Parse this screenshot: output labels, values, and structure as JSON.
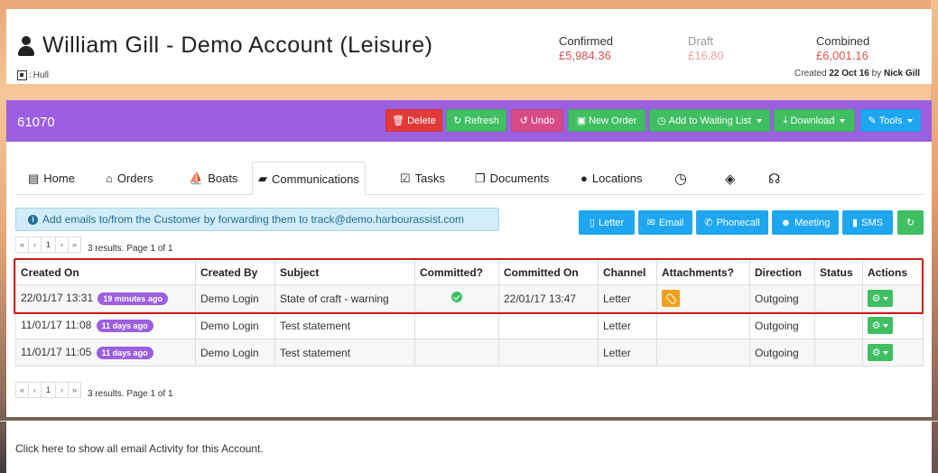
{
  "header": {
    "title": "William Gill - Demo Account (Leisure)",
    "location": "Hull",
    "confirmed_label": "Confirmed",
    "confirmed_value": "£5,984.36",
    "draft_label": "Draft",
    "draft_value": "£16.80",
    "combined_label": "Combined",
    "combined_value": "£6,001.16",
    "created_prefix": "Created",
    "created_date": "22 Oct 16",
    "created_by_word": "by",
    "created_by": "Nick Gill"
  },
  "toolbar": {
    "record_id": "61070",
    "delete": "Delete",
    "refresh": "Refresh",
    "undo": "Undo",
    "new_order": "New Order",
    "add_waiting": "Add to Waiting List",
    "download": "Download",
    "tools": "Tools"
  },
  "tabs": [
    {
      "label": "Home",
      "icon": "id-card-icon"
    },
    {
      "label": "Orders",
      "icon": "basket-icon"
    },
    {
      "label": "Boats",
      "icon": "sailboat-icon"
    },
    {
      "label": "Communications",
      "icon": "comments-icon"
    },
    {
      "label": "Tasks",
      "icon": "clipboard-check-icon"
    },
    {
      "label": "Documents",
      "icon": "documents-icon"
    },
    {
      "label": "Locations",
      "icon": "globe-icon"
    }
  ],
  "info": {
    "text": "Add emails to/from the Customer by forwarding them to track@demo.harbourassist.com"
  },
  "actions": {
    "letter": "Letter",
    "email": "Email",
    "phonecall": "Phonecall",
    "meeting": "Meeting",
    "sms": "SMS"
  },
  "pager": {
    "first": "«",
    "prev": "‹",
    "page": "1",
    "next": "›",
    "last": "»",
    "summary": "3 results. Page 1 of 1"
  },
  "table": {
    "headers": [
      "Created On",
      "Created By",
      "Subject",
      "Committed?",
      "Committed On",
      "Channel",
      "Attachments?",
      "Direction",
      "Status",
      "Actions"
    ],
    "rows": [
      {
        "created_on": "22/01/17 13:31",
        "age": "19 minutes ago",
        "created_by": "Demo Login",
        "subject": "State of craft - warning",
        "committed": true,
        "committed_on": "22/01/17 13:47",
        "channel": "Letter",
        "attachment": true,
        "direction": "Outgoing",
        "status": ""
      },
      {
        "created_on": "11/01/17 11:08",
        "age": "11 days ago",
        "created_by": "Demo Login",
        "subject": "Test statement",
        "committed": false,
        "committed_on": "",
        "channel": "Letter",
        "attachment": false,
        "direction": "Outgoing",
        "status": ""
      },
      {
        "created_on": "11/01/17 11:05",
        "age": "11 days ago",
        "created_by": "Demo Login",
        "subject": "Test statement",
        "committed": false,
        "committed_on": "",
        "channel": "Letter",
        "attachment": false,
        "direction": "Outgoing",
        "status": ""
      }
    ]
  },
  "footer": {
    "link": "Click here to show all email Activity for this Account."
  },
  "colors": {
    "toolbar": "#9b5fe0",
    "green": "#3fbf62",
    "blue": "#1ea7f0",
    "red": "#e23a3a",
    "highlight": "#d01818"
  }
}
